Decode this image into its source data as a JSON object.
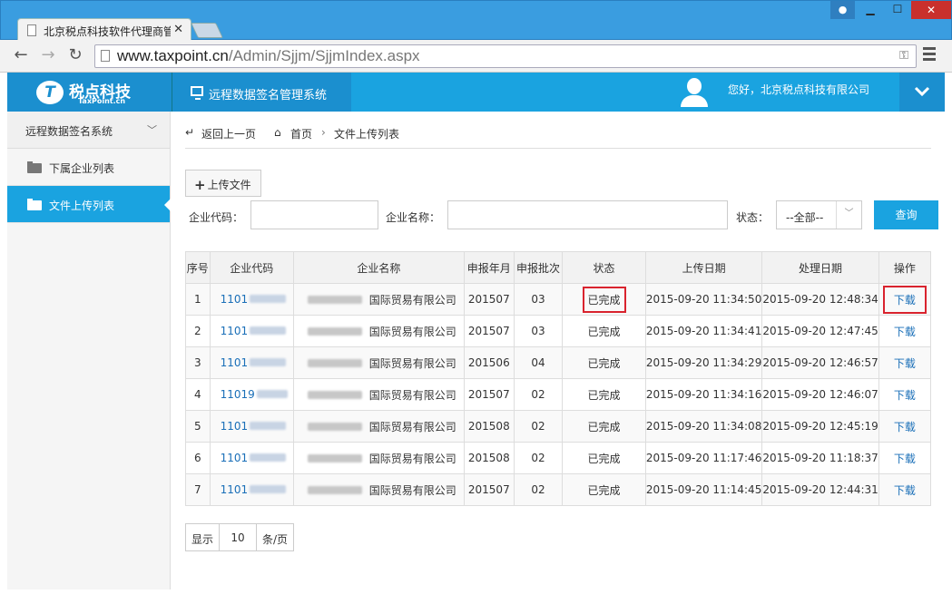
{
  "browser": {
    "tab_title": "北京税点科技软件代理商管",
    "url_host": "www.taxpoint.cn",
    "url_path": "/Admin/Sjjm/SjjmIndex.aspx"
  },
  "header": {
    "logo_name": "税点科技",
    "logo_sub": "TaxPoint.cn",
    "system_name": "远程数据签名管理系统",
    "greeting": "您好，北京税点科技有限公司"
  },
  "sidebar": {
    "section": "远程数据签名系统",
    "items": [
      {
        "label": "下属企业列表"
      },
      {
        "label": "文件上传列表"
      }
    ]
  },
  "breadcrumb": {
    "back": "返回上一页",
    "home": "首页",
    "current": "文件上传列表"
  },
  "toolbar": {
    "upload_label": "上传文件",
    "code_label": "企业代码：",
    "name_label": "企业名称：",
    "status_label": "状态：",
    "status_value": "--全部--",
    "query_label": "查询"
  },
  "table": {
    "headers": [
      "序号",
      "企业代码",
      "企业名称",
      "申报年月",
      "申报批次",
      "状态",
      "上传日期",
      "处理日期",
      "操作"
    ],
    "rows": [
      {
        "idx": "1",
        "code": "1101",
        "name": "国际贸易有限公司",
        "month": "201507",
        "batch": "03",
        "status": "已完成",
        "upload": "2015-09-20 11:34:50",
        "process": "2015-09-20 12:48:34",
        "op": "下载"
      },
      {
        "idx": "2",
        "code": "1101",
        "name": "国际贸易有限公司",
        "month": "201507",
        "batch": "03",
        "status": "已完成",
        "upload": "2015-09-20 11:34:41",
        "process": "2015-09-20 12:47:45",
        "op": "下载"
      },
      {
        "idx": "3",
        "code": "1101",
        "name": "国际贸易有限公司",
        "month": "201506",
        "batch": "04",
        "status": "已完成",
        "upload": "2015-09-20 11:34:29",
        "process": "2015-09-20 12:46:57",
        "op": "下载"
      },
      {
        "idx": "4",
        "code": "11019",
        "name": "国际贸易有限公司",
        "month": "201507",
        "batch": "02",
        "status": "已完成",
        "upload": "2015-09-20 11:34:16",
        "process": "2015-09-20 12:46:07",
        "op": "下载"
      },
      {
        "idx": "5",
        "code": "1101",
        "name": "国际贸易有限公司",
        "month": "201508",
        "batch": "02",
        "status": "已完成",
        "upload": "2015-09-20 11:34:08",
        "process": "2015-09-20 12:45:19",
        "op": "下载"
      },
      {
        "idx": "6",
        "code": "1101",
        "name": "国际贸易有限公司",
        "month": "201508",
        "batch": "02",
        "status": "已完成",
        "upload": "2015-09-20 11:17:46",
        "process": "2015-09-20 11:18:37",
        "op": "下载"
      },
      {
        "idx": "7",
        "code": "1101",
        "name": "国际贸易有限公司",
        "month": "201507",
        "batch": "02",
        "status": "已完成",
        "upload": "2015-09-20 11:14:45",
        "process": "2015-09-20 12:44:31",
        "op": "下载"
      }
    ]
  },
  "pager": {
    "show": "显示",
    "size": "10",
    "unit": "条/页"
  },
  "colors": {
    "accent": "#1aa3e0",
    "header_dark": "#1b8fcf",
    "highlight": "#d9232e",
    "link": "#1a6fb8"
  }
}
